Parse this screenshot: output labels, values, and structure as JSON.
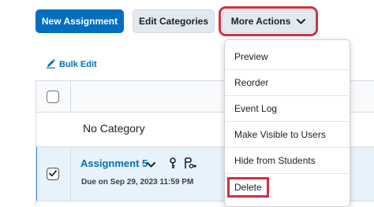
{
  "toolbar": {
    "new_assignment_label": "New Assignment",
    "edit_categories_label": "Edit Categories",
    "more_actions_label": "More Actions"
  },
  "bulk_edit_label": "Bulk Edit",
  "table": {
    "category_title": "No Category",
    "row": {
      "assignment_name": "Assignment 5",
      "due_text": "Due on Sep 29, 2023 11:59 PM",
      "selected": true
    }
  },
  "menu": {
    "items": [
      {
        "label": "Preview"
      },
      {
        "label": "Reorder"
      },
      {
        "label": "Event Log"
      },
      {
        "label": "Make Visible to Users"
      },
      {
        "label": "Hide from Students"
      },
      {
        "label": "Delete"
      }
    ]
  },
  "colors": {
    "accent": "#006fbf",
    "highlight_outline": "#d1303f",
    "selected_row": "#e8f2fb"
  },
  "icons": [
    "chevron-down-icon",
    "pencil-icon",
    "checkbox-icon",
    "key-icon",
    "release-conditions-icon"
  ]
}
